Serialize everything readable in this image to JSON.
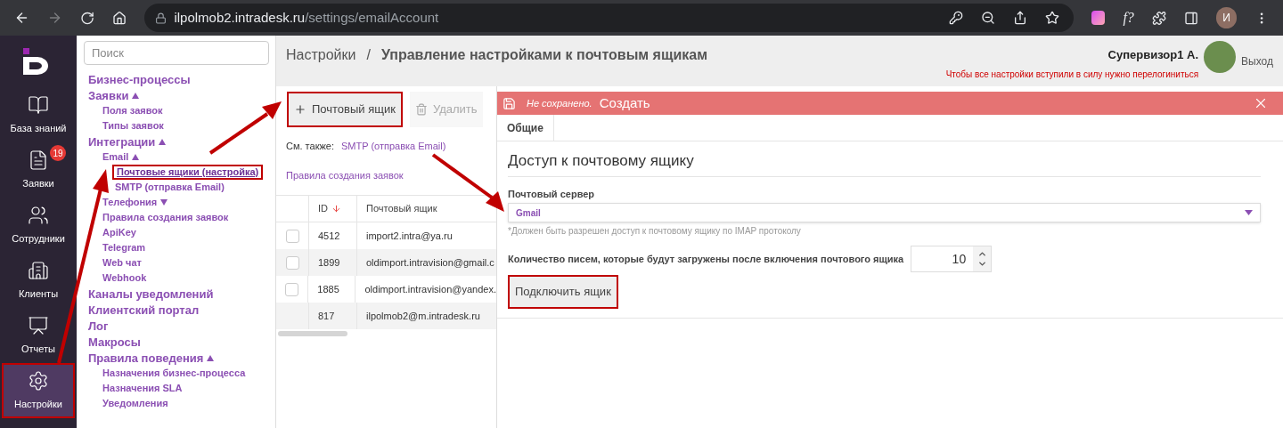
{
  "browser": {
    "url_host": "ilpolmob2.intradesk.ru",
    "url_path": "/settings/emailAccount",
    "extension_label": "f?",
    "profile_initial": "И"
  },
  "nav": [
    {
      "label": "База знаний",
      "selected": false,
      "highlighted": false
    },
    {
      "label": "Заявки",
      "selected": false,
      "highlighted": false,
      "badge": "19"
    },
    {
      "label": "Сотрудники",
      "selected": false,
      "highlighted": false
    },
    {
      "label": "Клиенты",
      "selected": false,
      "highlighted": false
    },
    {
      "label": "Отчеты",
      "selected": false,
      "highlighted": false
    },
    {
      "label": "Настройки",
      "selected": true,
      "highlighted": true
    }
  ],
  "settings_menu": {
    "search": {
      "placeholder": "Поиск"
    },
    "items": [
      {
        "label": "Бизнес-процессы",
        "selected": false,
        "highlighted": false
      },
      {
        "label": "Заявки",
        "expanded": true,
        "selected": false,
        "highlighted": false,
        "children": [
          {
            "label": "Поля заявок",
            "selected": false,
            "highlighted": false
          },
          {
            "label": "Типы заявок",
            "selected": false,
            "highlighted": false
          }
        ]
      },
      {
        "label": "Интеграции",
        "expanded": true,
        "selected": false,
        "highlighted": false,
        "children": [
          {
            "label": "Email",
            "expanded": true,
            "selected": false,
            "highlighted": false,
            "children": [
              {
                "label": "Почтовые ящики (настройка)",
                "selected": true,
                "highlighted": true
              },
              {
                "label": "SMTP (отправка Email)",
                "selected": false,
                "highlighted": false
              }
            ]
          },
          {
            "label": "Телефония",
            "expanded": false,
            "selected": false,
            "highlighted": false
          },
          {
            "label": "Правила создания заявок",
            "selected": false,
            "highlighted": false
          },
          {
            "label": "ApiKey",
            "selected": false,
            "highlighted": false
          },
          {
            "label": "Telegram",
            "selected": false,
            "highlighted": false
          },
          {
            "label": "Web чат",
            "selected": false,
            "highlighted": false
          },
          {
            "label": "Webhook",
            "selected": false,
            "highlighted": false
          }
        ]
      },
      {
        "label": "Каналы уведомлений",
        "selected": false,
        "highlighted": false
      },
      {
        "label": "Клиентский портал",
        "selected": false,
        "highlighted": false
      },
      {
        "label": "Лог",
        "selected": false,
        "highlighted": false
      },
      {
        "label": "Макросы",
        "selected": false,
        "highlighted": false
      },
      {
        "label": "Правила поведения",
        "expanded": true,
        "selected": false,
        "highlighted": false,
        "children": [
          {
            "label": "Назначения бизнес-процесса",
            "selected": false,
            "highlighted": false
          },
          {
            "label": "Назначения SLA",
            "selected": false,
            "highlighted": false
          },
          {
            "label": "Уведомления",
            "selected": false,
            "highlighted": false
          }
        ]
      }
    ]
  },
  "header": {
    "breadcrumb": [
      "Настройки",
      "Управление настройками к почтовым ящикам"
    ],
    "separator": "/",
    "user_name": "Супервизор1 А.",
    "warning": "Чтобы все настройки вступили в силу нужно перелогиниться",
    "logout": "Выход"
  },
  "list_panel": {
    "toolbar": [
      {
        "kind": "add",
        "label": "Почтовый ящик",
        "disabled": false,
        "highlighted": true
      },
      {
        "kind": "delete",
        "label": "Удалить",
        "disabled": true,
        "highlighted": false
      }
    ],
    "see_also_label": "См. также:",
    "see_also_links": [
      "SMTP (отправка Email)",
      "Правила создания заявок"
    ],
    "table": {
      "columns": [
        "ID",
        "Почтовый ящик"
      ],
      "rows": [
        {
          "kind": "checkbox",
          "checked": false,
          "cells": [
            "4512",
            "import2.intra@ya.ru"
          ]
        },
        {
          "kind": "checkbox",
          "checked": false,
          "cells": [
            "1899",
            "oldimport.intravision@gmail.c"
          ]
        },
        {
          "kind": "checkbox",
          "checked": false,
          "cells": [
            "1885",
            "oldimport.intravision@yandex."
          ]
        },
        {
          "kind": "plain",
          "cells": [
            "817",
            "ilpolmob2@m.intradesk.ru"
          ]
        }
      ]
    }
  },
  "form": {
    "status": "Не сохранено.",
    "title": "Создать",
    "tabs": [
      {
        "label": "Общие",
        "selected": true
      }
    ],
    "section_title": "Доступ к почтовому ящику",
    "server_label": "Почтовый сервер",
    "server_value": "Gmail",
    "server_hint": "*Должен быть разрешен доступ к почтовому ящику по IMAP протоколу",
    "count_label": "Количество писем, которые будут загружены после включения почтового ящика",
    "count_value": "10",
    "connect_button": {
      "label": "Подключить ящик",
      "highlighted": true
    }
  }
}
